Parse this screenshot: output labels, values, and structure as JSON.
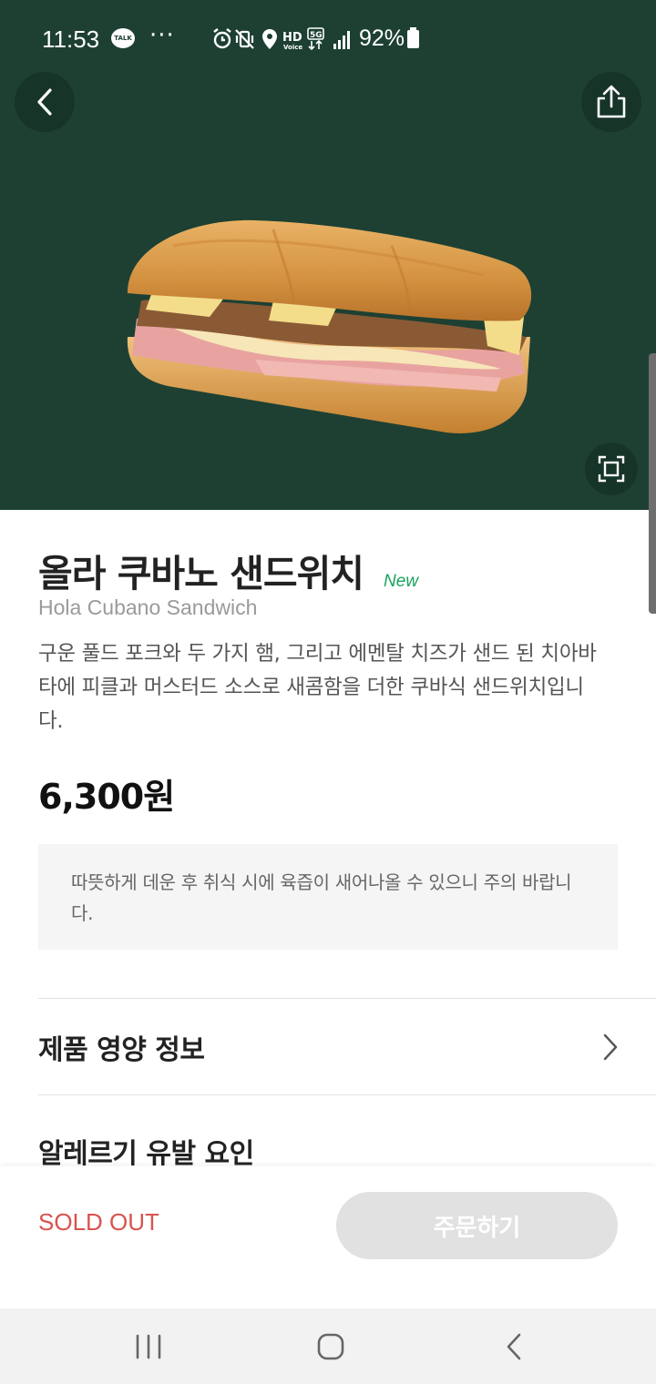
{
  "status_bar": {
    "time": "11:53",
    "talk_badge": "TALK",
    "more": "···",
    "battery": "92%"
  },
  "header": {
    "back_icon": "back-arrow",
    "share_icon": "share-icon",
    "expand_icon": "expand-icon"
  },
  "product": {
    "name_kr": "올라 쿠바노 샌드위치",
    "badge": "New",
    "name_en": "Hola Cubano Sandwich",
    "description": "구운 풀드 포크와 두 가지 햄, 그리고 에멘탈 치즈가 샌드 된 치아바타에 피클과 머스터드 소스로 새콤함을 더한 쿠바식 샌드위치입니다.",
    "price": "6,300원",
    "notice": "따뜻하게 데운 후 취식 시에 육즙이 새어나올 수 있으니 주의 바랍니다."
  },
  "sections": {
    "nutrition": "제품 영양 정보",
    "allergy": "알레르기 유발 요인"
  },
  "bottom": {
    "status": "SOLD OUT",
    "order_button": "주문하기"
  },
  "colors": {
    "hero_bg": "#1d4033",
    "new_badge": "#1aa25f",
    "sold_out": "#d9534f",
    "order_disabled": "#e1e1e1"
  }
}
